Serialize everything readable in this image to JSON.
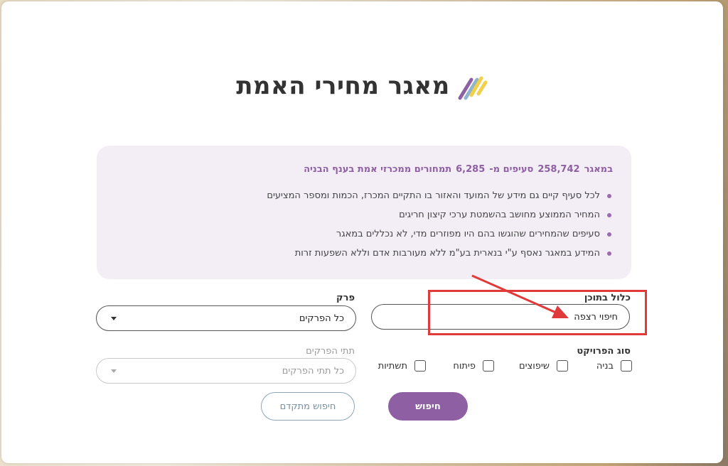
{
  "header": {
    "title": "מאגר מחירי האמת"
  },
  "info": {
    "summary_prefix": "במאגר",
    "summary_items_count": "258,742",
    "summary_items_text": "סעיפים מ-",
    "summary_tenders_count": "6,285",
    "summary_tenders_text": "תמחורים ממכרזי אמת בענף הבניה",
    "bullets": [
      "לכל סעיף קיים גם מידע של המועד והאזור בו התקיים המכרז, הכמות ומספר המציעים",
      "המחיר הממוצע מחושב בהשמטת ערכי קיצון חריגים",
      "סעיפים שהמחירים שהוגשו בהם היו מפוזרים מדי, לא נכללים במאגר",
      "המידע במאגר נאסף ע\"י בנארית בע\"מ ללא מעורבות אדם וללא השפעות זרות"
    ]
  },
  "search": {
    "content_label": "כלול בתוכן",
    "content_value": "חיפוי רצפה",
    "chapter_label": "פרק",
    "chapter_value": "כל הפרקים",
    "subchapter_label": "תתי הפרקים",
    "subchapter_value": "כל תתי הפרקים",
    "project_type_label": "סוג הפרויקט",
    "project_types": [
      "בניה",
      "שיפוצים",
      "פיתוח",
      "תשתיות"
    ],
    "search_button": "חיפוש",
    "advanced_button": "חיפוש מתקדם"
  },
  "colors": {
    "accent": "#8e5fa3",
    "info_bg": "#f3eef6",
    "annotation": "#e03a3a"
  }
}
